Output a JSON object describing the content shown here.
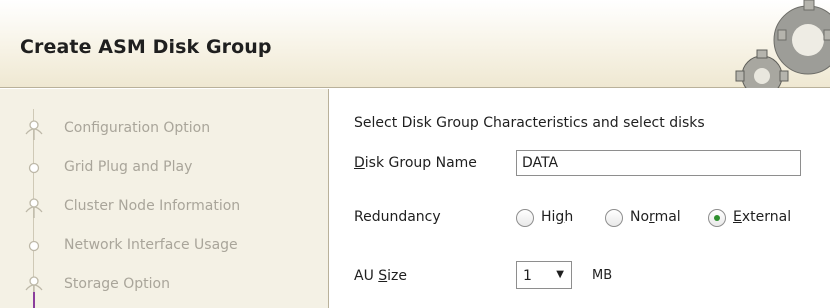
{
  "header": {
    "title": "Create ASM Disk Group"
  },
  "nav": {
    "items": [
      {
        "label": "Configuration Option",
        "icon": "step-person-icon"
      },
      {
        "label": "Grid Plug and Play",
        "icon": "step-dot-icon"
      },
      {
        "label": "Cluster Node Information",
        "icon": "step-person-icon"
      },
      {
        "label": "Network Interface Usage",
        "icon": "step-dot-icon"
      },
      {
        "label": "Storage Option",
        "icon": "step-person-icon"
      }
    ]
  },
  "form": {
    "instruction": "Select Disk Group Characteristics and select disks",
    "disk_group_name": {
      "label_mnemonic": "D",
      "label_rest": "isk Group Name",
      "value": "DATA"
    },
    "redundancy": {
      "label": "Redundancy",
      "options": [
        {
          "pre": "Hi",
          "mnemonic": "g",
          "post": "h",
          "selected": false
        },
        {
          "pre": "No",
          "mnemonic": "r",
          "post": "mal",
          "selected": false
        },
        {
          "pre": "",
          "mnemonic": "E",
          "post": "xternal",
          "selected": true
        }
      ]
    },
    "au_size": {
      "label_pre": "AU ",
      "label_mnemonic": "S",
      "label_post": "ize",
      "value": "1",
      "unit": "MB"
    }
  }
}
